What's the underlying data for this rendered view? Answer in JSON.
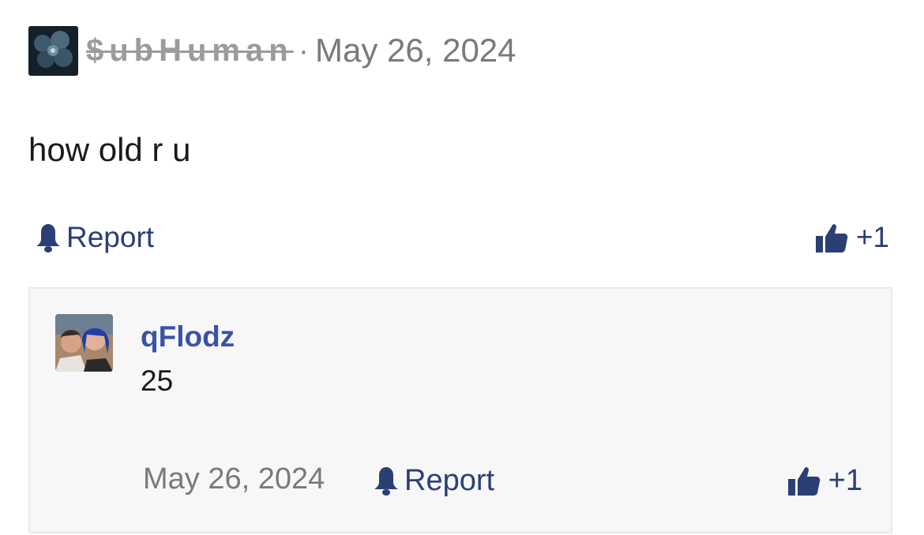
{
  "post": {
    "username": "$ubHuman",
    "separator": "·",
    "date": "May 26, 2024",
    "body": "how old r u",
    "report_label": "Report",
    "like_count": "+1"
  },
  "reply": {
    "username": "qFlodz",
    "body": "25",
    "date": "May 26, 2024",
    "report_label": "Report",
    "like_count": "+1"
  },
  "colors": {
    "link_blue": "#2b3f75",
    "username_blue": "#3a52a8",
    "muted_gray": "#7a7a7a",
    "reply_background": "#f7f7f7"
  },
  "icons": {
    "report": "bell-icon",
    "like": "thumbs-up-icon"
  }
}
